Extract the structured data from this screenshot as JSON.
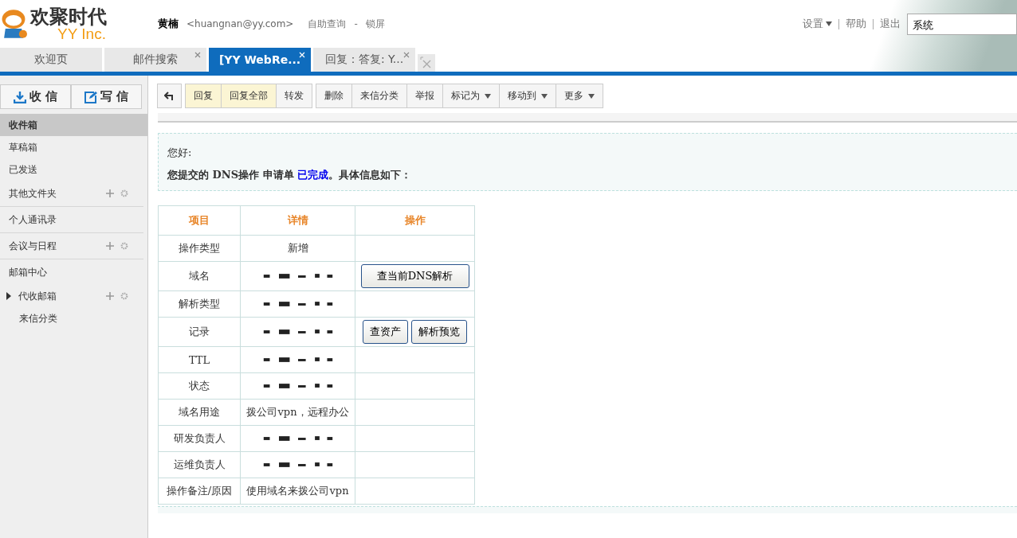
{
  "logo": {
    "name": "欢聚时代",
    "sub": "YY Inc."
  },
  "user": {
    "name": "黄楠",
    "email": "<huangnan@yy.com>",
    "links": [
      "自助查询",
      "-",
      "锁屏"
    ]
  },
  "top_links": [
    {
      "label": "设置",
      "dropdown": true
    },
    {
      "label": "帮助",
      "dropdown": false
    },
    {
      "label": "退出",
      "dropdown": false
    }
  ],
  "search": {
    "value": "系统"
  },
  "tabs": [
    {
      "label": "欢迎页",
      "selected": false,
      "closable": false
    },
    {
      "label": "邮件搜索",
      "selected": false,
      "closable": true
    },
    {
      "label": "[YY WebRe...",
      "selected": true,
      "closable": true
    },
    {
      "label": "回复：答复: Y...",
      "selected": false,
      "closable": true
    }
  ],
  "compose": [
    "收 信",
    "写 信"
  ],
  "sidebar": {
    "items": [
      {
        "label": "收件箱",
        "selected": true,
        "tools": false,
        "kind": "folder"
      },
      {
        "label": "草稿箱",
        "selected": false,
        "tools": false,
        "kind": "folder"
      },
      {
        "label": "已发送",
        "selected": false,
        "tools": false,
        "kind": "folder"
      },
      {
        "label": "其他文件夹",
        "selected": false,
        "tools": true,
        "kind": "section"
      },
      {
        "label": "个人通讯录",
        "selected": false,
        "tools": false,
        "kind": "section"
      },
      {
        "label": "会议与日程",
        "selected": false,
        "tools": true,
        "kind": "section"
      },
      {
        "label": "邮箱中心",
        "selected": false,
        "tools": false,
        "kind": "group",
        "children": [
          {
            "label": "代收邮箱",
            "selected": false,
            "tools": true,
            "expanded": false
          },
          {
            "label": "来信分类",
            "selected": false,
            "tools": false
          }
        ]
      }
    ]
  },
  "toolbar": [
    [
      {
        "label": "回复",
        "highlighted": true,
        "dropdown": false
      },
      {
        "label": "回复全部",
        "highlighted": true,
        "dropdown": false
      },
      {
        "label": "转发",
        "highlighted": false,
        "dropdown": false
      }
    ],
    [
      {
        "label": "删除",
        "highlighted": false,
        "dropdown": false
      },
      {
        "label": "来信分类",
        "highlighted": false,
        "dropdown": false
      },
      {
        "label": "举报",
        "highlighted": false,
        "dropdown": false
      },
      {
        "label": "标记为",
        "highlighted": false,
        "dropdown": true
      },
      {
        "label": "移动到",
        "highlighted": false,
        "dropdown": true
      },
      {
        "label": "更多",
        "highlighted": false,
        "dropdown": true
      }
    ]
  ],
  "message": {
    "greeting": "您好:",
    "body": "您提交的 DNS操作 申请单 ",
    "status": "已完成",
    "tail": "。具体信息如下："
  },
  "table": {
    "columns": [
      "项目",
      "详情",
      "操作"
    ],
    "rows": [
      {
        "item": "操作类型",
        "kind": "text",
        "detail": "新增",
        "actions": []
      },
      {
        "item": "域名",
        "kind": "redacted",
        "actions": [
          "查当前DNS解析"
        ]
      },
      {
        "item": "解析类型",
        "kind": "redacted",
        "actions": []
      },
      {
        "item": "记录",
        "kind": "redacted",
        "actions": [
          "查资产",
          "解析预览"
        ]
      },
      {
        "item": "TTL",
        "kind": "redacted",
        "actions": []
      },
      {
        "item": "状态",
        "kind": "redacted",
        "actions": []
      },
      {
        "item": "域名用途",
        "kind": "text",
        "detail": "拨公司vpn，远程办公",
        "actions": []
      },
      {
        "item": "研发负责人",
        "kind": "redacted",
        "actions": []
      },
      {
        "item": "运维负责人",
        "kind": "redacted",
        "actions": []
      },
      {
        "item": "操作备注/原因",
        "kind": "text",
        "detail": "使用域名来拨公司vpn",
        "actions": []
      }
    ]
  }
}
